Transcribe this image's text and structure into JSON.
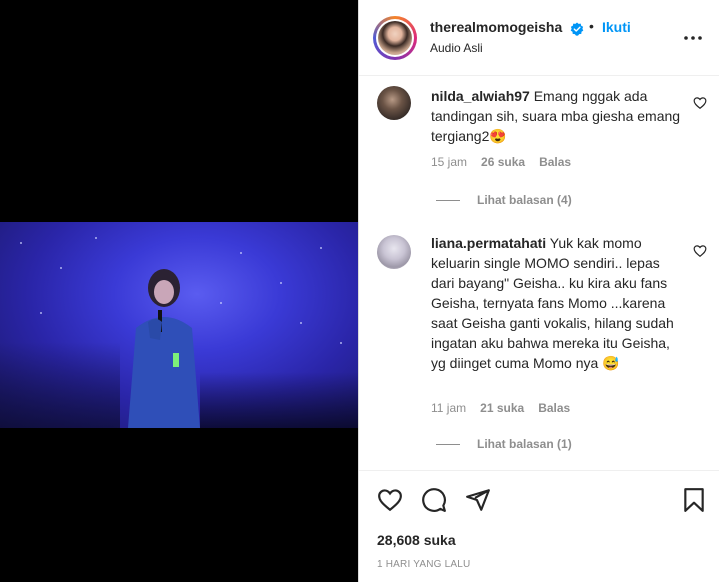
{
  "post": {
    "username": "therealmomogeisha",
    "follow_label": "Ikuti",
    "dot": "•",
    "audio": "Audio Asli"
  },
  "comments": [
    {
      "username": "nilda_alwiah97",
      "text": "Emang nggak ada tandingan sih, suara mba giesha emang tergiang2😍",
      "time": "15 jam",
      "likes": "26 suka",
      "reply": "Balas",
      "view_replies": "Lihat balasan (4)"
    },
    {
      "username": "liana.permatahati",
      "text": "Yuk kak momo keluarin single MOMO sendiri.. lepas dari bayang\" Geisha.. ku kira aku fans Geisha, ternyata fans Momo ...karena saat Geisha ganti vokalis, hilang sudah ingatan aku bahwa mereka itu Geisha, yg diinget cuma Momo nya 😅",
      "time": "11 jam",
      "likes": "21 suka",
      "reply": "Balas",
      "view_replies": "Lihat balasan (1)"
    }
  ],
  "footer": {
    "likes": "28,608 suka",
    "posted_ago": "1 HARI YANG LALU"
  },
  "icons": {
    "verified": "verified-badge-icon",
    "more": "more-options-icon",
    "like": "heart-icon",
    "comment": "comment-bubble-icon",
    "share": "paper-plane-icon",
    "save": "bookmark-icon"
  },
  "colors": {
    "accent": "#0095f6",
    "text": "#262626",
    "muted": "#8e8e8e"
  }
}
